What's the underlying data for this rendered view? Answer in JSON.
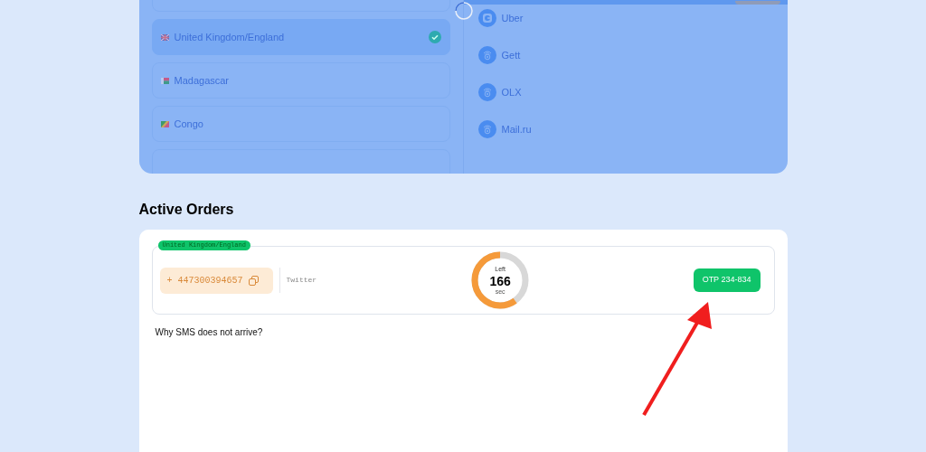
{
  "countries": [
    {
      "selected": false,
      "kind": "blank"
    },
    {
      "name": "United Kingdom/England",
      "selected": true,
      "kind": "uk"
    },
    {
      "name": "Madagascar",
      "selected": false,
      "kind": "mg"
    },
    {
      "name": "Congo",
      "selected": false,
      "kind": "cg"
    }
  ],
  "services": [
    {
      "name": "Uber",
      "kind": "uber"
    },
    {
      "name": "Gett",
      "kind": "generic"
    },
    {
      "name": "OLX",
      "kind": "generic"
    },
    {
      "name": "Mail.ru",
      "kind": "generic"
    }
  ],
  "section_title": "Active Orders",
  "order": {
    "country_tag": "United Kingdom/England",
    "phone": "+ 447300394657",
    "service": "Twitter",
    "timer": {
      "label": "Left",
      "value": "166",
      "unit": "sec",
      "level": 0.6
    },
    "otp_button": "OTP 234-834"
  },
  "help_link": "Why SMS does not arrive?"
}
